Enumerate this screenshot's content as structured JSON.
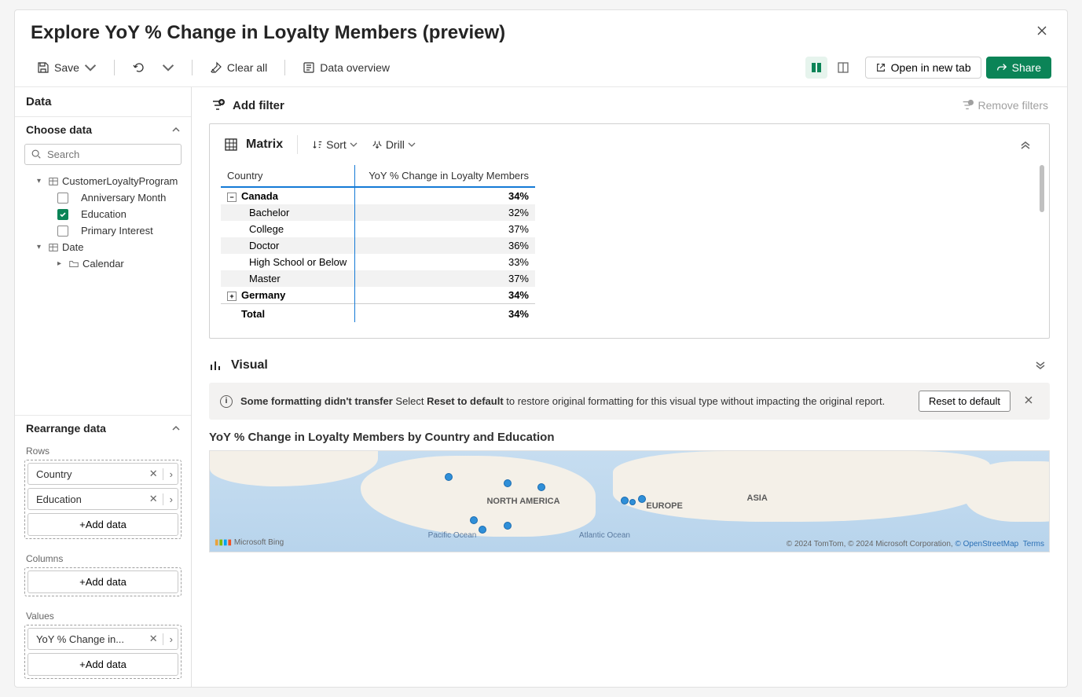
{
  "title": "Explore YoY % Change in Loyalty Members (preview)",
  "toolbar": {
    "save": "Save",
    "clear_all": "Clear all",
    "data_overview": "Data overview",
    "open_new_tab": "Open in new tab",
    "share": "Share"
  },
  "data_pane": {
    "header": "Data",
    "choose_data": "Choose data",
    "search_placeholder": "Search",
    "tree": {
      "table1": "CustomerLoyaltyProgram",
      "fields": [
        {
          "label": "Anniversary Month",
          "checked": false
        },
        {
          "label": "Education",
          "checked": true
        },
        {
          "label": "Primary Interest",
          "checked": false
        }
      ],
      "table2": "Date",
      "subfolder": "Calendar"
    },
    "rearrange": "Rearrange data",
    "rows_label": "Rows",
    "columns_label": "Columns",
    "values_label": "Values",
    "row_chips": [
      "Country",
      "Education"
    ],
    "value_chips": [
      "YoY % Change in..."
    ],
    "add_data": "+Add data"
  },
  "filter_bar": {
    "add_filter": "Add filter",
    "remove_filters": "Remove filters"
  },
  "matrix_card": {
    "title": "Matrix",
    "sort": "Sort",
    "drill": "Drill",
    "col0": "Country",
    "col1": "YoY % Change in Loyalty Members"
  },
  "chart_data": {
    "type": "table",
    "columns": [
      "Country",
      "Education",
      "YoY % Change in Loyalty Members"
    ],
    "rows": [
      {
        "level": 0,
        "label": "Canada",
        "value": "34%",
        "expanded": true
      },
      {
        "level": 1,
        "label": "Bachelor",
        "value": "32%"
      },
      {
        "level": 1,
        "label": "College",
        "value": "37%"
      },
      {
        "level": 1,
        "label": "Doctor",
        "value": "36%"
      },
      {
        "level": 1,
        "label": "High School or Below",
        "value": "33%"
      },
      {
        "level": 1,
        "label": "Master",
        "value": "37%"
      },
      {
        "level": 0,
        "label": "Germany",
        "value": "34%",
        "expanded": false
      }
    ],
    "total": {
      "label": "Total",
      "value": "34%"
    }
  },
  "visual": {
    "header": "Visual",
    "banner_bold1": "Some formatting didn't transfer",
    "banner_mid": " Select ",
    "banner_bold2": "Reset to default",
    "banner_rest": " to restore original formatting for this visual type without impacting the original report.",
    "reset_btn": "Reset to default",
    "chart_title": "YoY % Change in Loyalty Members by Country and Education",
    "map": {
      "na": "NORTH AMERICA",
      "eu": "EUROPE",
      "asia": "ASIA",
      "pacific": "Pacific Ocean",
      "atlantic": "Atlantic Ocean",
      "bing": "Microsoft Bing",
      "attr_pre": "© 2024 TomTom, © 2024 Microsoft Corporation, ",
      "attr_link1": "© OpenStreetMap",
      "attr_link2": "Terms"
    }
  }
}
